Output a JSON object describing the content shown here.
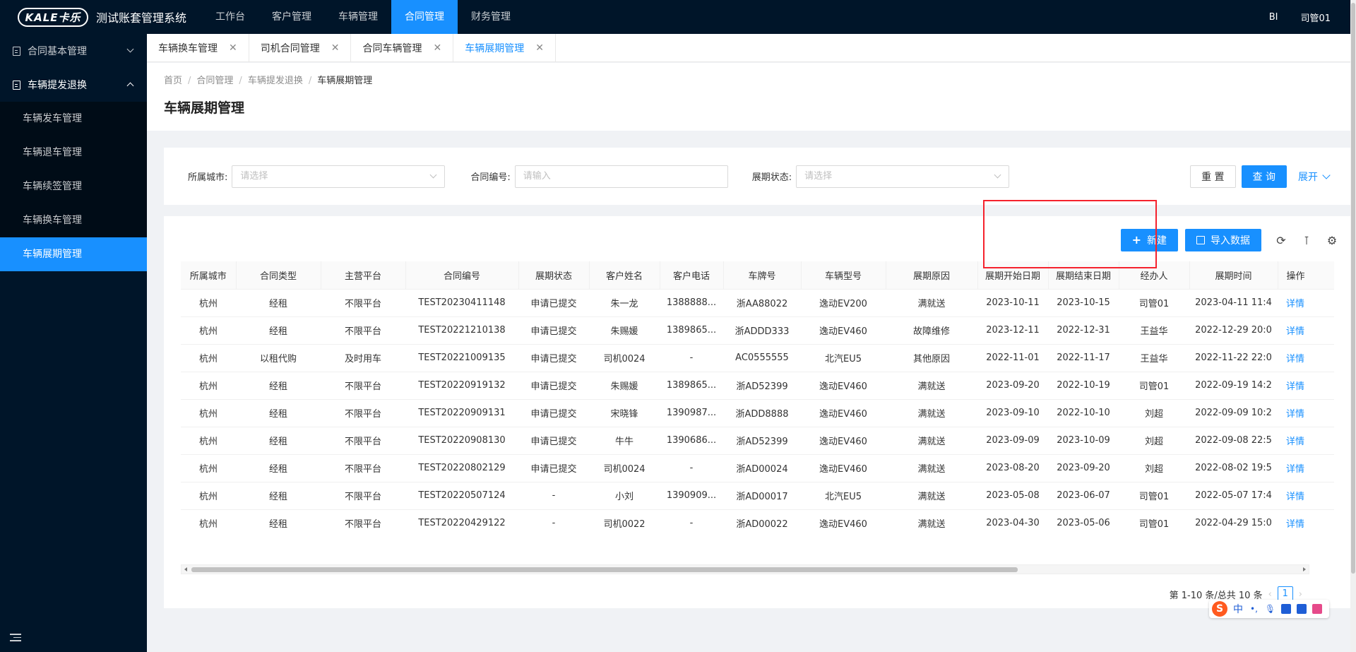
{
  "app": {
    "logo_text": "KALE卡乐",
    "system_title": "测试账套管理系统",
    "user_badge": "BI",
    "user_name": "司管01"
  },
  "top_nav": [
    {
      "label": "工作台",
      "active": false
    },
    {
      "label": "客户管理",
      "active": false
    },
    {
      "label": "车辆管理",
      "active": false
    },
    {
      "label": "合同管理",
      "active": true
    },
    {
      "label": "财务管理",
      "active": false
    }
  ],
  "sidebar": {
    "groups": [
      {
        "label": "合同基本管理",
        "open": false
      },
      {
        "label": "车辆提发退换",
        "open": true
      }
    ],
    "items": [
      {
        "label": "车辆发车管理",
        "active": false
      },
      {
        "label": "车辆退车管理",
        "active": false
      },
      {
        "label": "车辆续签管理",
        "active": false
      },
      {
        "label": "车辆换车管理",
        "active": false
      },
      {
        "label": "车辆展期管理",
        "active": true
      }
    ]
  },
  "tabs": [
    {
      "label": "车辆换车管理",
      "active": false
    },
    {
      "label": "司机合同管理",
      "active": false
    },
    {
      "label": "合同车辆管理",
      "active": false
    },
    {
      "label": "车辆展期管理",
      "active": true
    }
  ],
  "breadcrumb": [
    "首页",
    "合同管理",
    "车辆提发退换",
    "车辆展期管理"
  ],
  "page_title": "车辆展期管理",
  "search": {
    "city_label": "所属城市:",
    "city_placeholder": "请选择",
    "contract_label": "合同编号:",
    "contract_placeholder": "请输入",
    "status_label": "展期状态:",
    "status_placeholder": "请选择",
    "reset_label": "重 置",
    "query_label": "查 询",
    "expand_label": "展开"
  },
  "toolbar": {
    "new_label": "新建",
    "import_label": "导入数据"
  },
  "table": {
    "columns": [
      "所属城市",
      "合同类型",
      "主营平台",
      "合同编号",
      "展期状态",
      "客户姓名",
      "客户电话",
      "车牌号",
      "车辆型号",
      "展期原因",
      "展期开始日期",
      "展期结束日期",
      "经办人",
      "展期时间",
      "操作"
    ],
    "rows": [
      [
        "杭州",
        "经租",
        "不限平台",
        "TEST20230411148",
        "申请已提交",
        "朱一龙",
        "1388888...",
        "浙AA88022",
        "逸动EV200",
        "满就送",
        "2023-10-11",
        "2023-10-15",
        "司管01",
        "2023-04-11 11:4",
        "详情"
      ],
      [
        "杭州",
        "经租",
        "不限平台",
        "TEST20221210138",
        "申请已提交",
        "朱赐媛",
        "1389865...",
        "浙ADDD333",
        "逸动EV460",
        "故障维修",
        "2023-12-11",
        "2022-12-31",
        "王益华",
        "2022-12-29 20:0",
        "详情"
      ],
      [
        "杭州",
        "以租代购",
        "及时用车",
        "TEST20221009135",
        "申请已提交",
        "司机0024",
        "-",
        "AC0555555",
        "北汽EU5",
        "其他原因",
        "2022-11-01",
        "2022-11-17",
        "王益华",
        "2022-11-22 22:0",
        "详情"
      ],
      [
        "杭州",
        "经租",
        "不限平台",
        "TEST20220919132",
        "申请已提交",
        "朱赐媛",
        "1389865...",
        "浙AD52399",
        "逸动EV460",
        "满就送",
        "2023-09-20",
        "2022-10-19",
        "司管01",
        "2022-09-19 14:2",
        "详情"
      ],
      [
        "杭州",
        "经租",
        "不限平台",
        "TEST20220909131",
        "申请已提交",
        "宋晓锋",
        "1390987...",
        "浙ADD8888",
        "逸动EV460",
        "满就送",
        "2023-09-10",
        "2022-10-10",
        "刘超",
        "2022-09-09 10:2",
        "详情"
      ],
      [
        "杭州",
        "经租",
        "不限平台",
        "TEST20220908130",
        "申请已提交",
        "牛牛",
        "1390686...",
        "浙AD52399",
        "逸动EV460",
        "满就送",
        "2023-09-09",
        "2023-10-09",
        "刘超",
        "2022-09-08 22:5",
        "详情"
      ],
      [
        "杭州",
        "经租",
        "不限平台",
        "TEST20220802129",
        "申请已提交",
        "司机0024",
        "-",
        "浙AD00024",
        "逸动EV460",
        "满就送",
        "2023-08-20",
        "2023-09-20",
        "刘超",
        "2022-08-02 19:5",
        "详情"
      ],
      [
        "杭州",
        "经租",
        "不限平台",
        "TEST20220507124",
        "-",
        "小刘",
        "1390909...",
        "浙AD00017",
        "北汽EU5",
        "满就送",
        "2023-05-08",
        "2023-06-07",
        "司管01",
        "2022-05-07 17:4",
        "详情"
      ],
      [
        "杭州",
        "经租",
        "不限平台",
        "TEST20220429122",
        "-",
        "司机0022",
        "-",
        "浙AD00022",
        "逸动EV460",
        "满就送",
        "2023-04-30",
        "2023-05-06",
        "司管01",
        "2022-04-29 15:0",
        "详情"
      ],
      [
        "杭州",
        "租赁（UP模式）",
        "不限平台",
        "TEST20220330116",
        "-",
        "司机0015",
        "1345614...",
        "浙AD00016",
        "EX5-400",
        "满就送",
        "2023-03-30",
        "2022-04-30",
        "刘超",
        "2022-03-30 13:0",
        "详情"
      ]
    ]
  },
  "pagination": {
    "summary": "第 1-10 条/总共 10 条",
    "current_page": "1"
  },
  "ime": {
    "logo": "S",
    "lang": "中"
  }
}
